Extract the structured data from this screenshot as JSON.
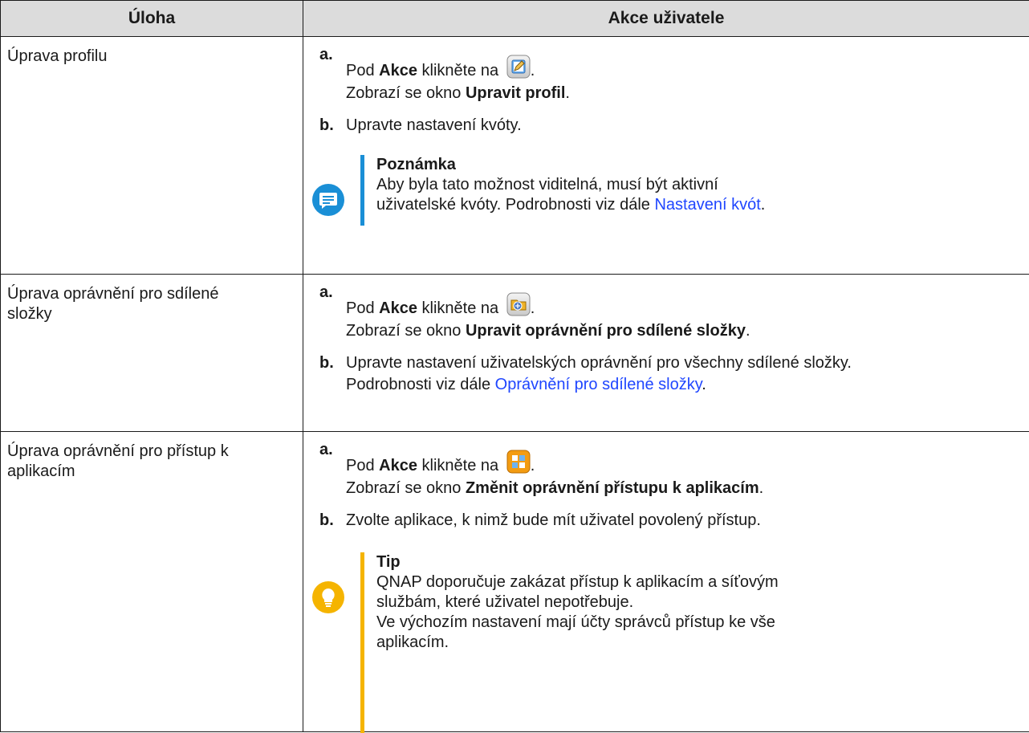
{
  "headers": {
    "task": "Úloha",
    "actions": "Akce uživatele"
  },
  "colors": {
    "header_bg": "#dcdcdc",
    "link": "#1f46ff",
    "note_accent": "#1a8fd6",
    "tip_accent": "#f5b400"
  },
  "rows": [
    {
      "task": "Úprava profilu",
      "step_a": {
        "letter": "a.",
        "pre": "Pod ",
        "bold": "Akce",
        "mid": " klikněte na ",
        "post": ".",
        "line2_pre": "Zobrazí se okno ",
        "line2_bold": "Upravit profil",
        "line2_post": ".",
        "icon": "edit-profile-icon"
      },
      "step_b": {
        "letter": "b.",
        "text": "Upravte nastavení kvóty."
      },
      "note": {
        "icon": "note-icon",
        "title": "Poznámka",
        "line1": "Aby byla tato možnost viditelná, musí být aktivní",
        "line2_pre": "uživatelské kvóty. Podrobnosti viz dále ",
        "link": "Nastavení kvót",
        "line2_post": "."
      }
    },
    {
      "task": "Úprava oprávnění pro sdílené složky",
      "step_a": {
        "letter": "a.",
        "pre": "Pod ",
        "bold": "Akce",
        "mid": " klikněte na ",
        "post": ".",
        "line2_pre": "Zobrazí se okno ",
        "line2_bold": "Upravit oprávnění pro sdílené složky",
        "line2_post": ".",
        "icon": "shared-folder-permission-icon"
      },
      "step_b": {
        "letter": "b.",
        "text": "Upravte nastavení uživatelských oprávnění pro všechny sdílené složky.",
        "line2_pre": "Podrobnosti viz dále ",
        "link": "Oprávnění pro sdílené složky",
        "line2_post": "."
      }
    },
    {
      "task": "Úprava oprávnění pro přístup k aplikacím",
      "step_a": {
        "letter": "a.",
        "pre": "Pod ",
        "bold": "Akce",
        "mid": " klikněte na ",
        "post": ".",
        "line2_pre": "Zobrazí se okno ",
        "line2_bold": "Změnit oprávnění přístupu k aplikacím",
        "line2_post": ".",
        "icon": "app-privilege-icon"
      },
      "step_b": {
        "letter": "b.",
        "text": "Zvolte aplikace, k nimž bude mít uživatel povolený přístup."
      },
      "tip": {
        "icon": "lightbulb-icon",
        "title": "Tip",
        "lines": [
          "QNAP doporučuje zakázat přístup k aplikacím a síťovým",
          "službám, které uživatel nepotřebuje.",
          "Ve výchozím nastavení mají účty správců přístup ke vše",
          "aplikacím."
        ]
      }
    }
  ]
}
